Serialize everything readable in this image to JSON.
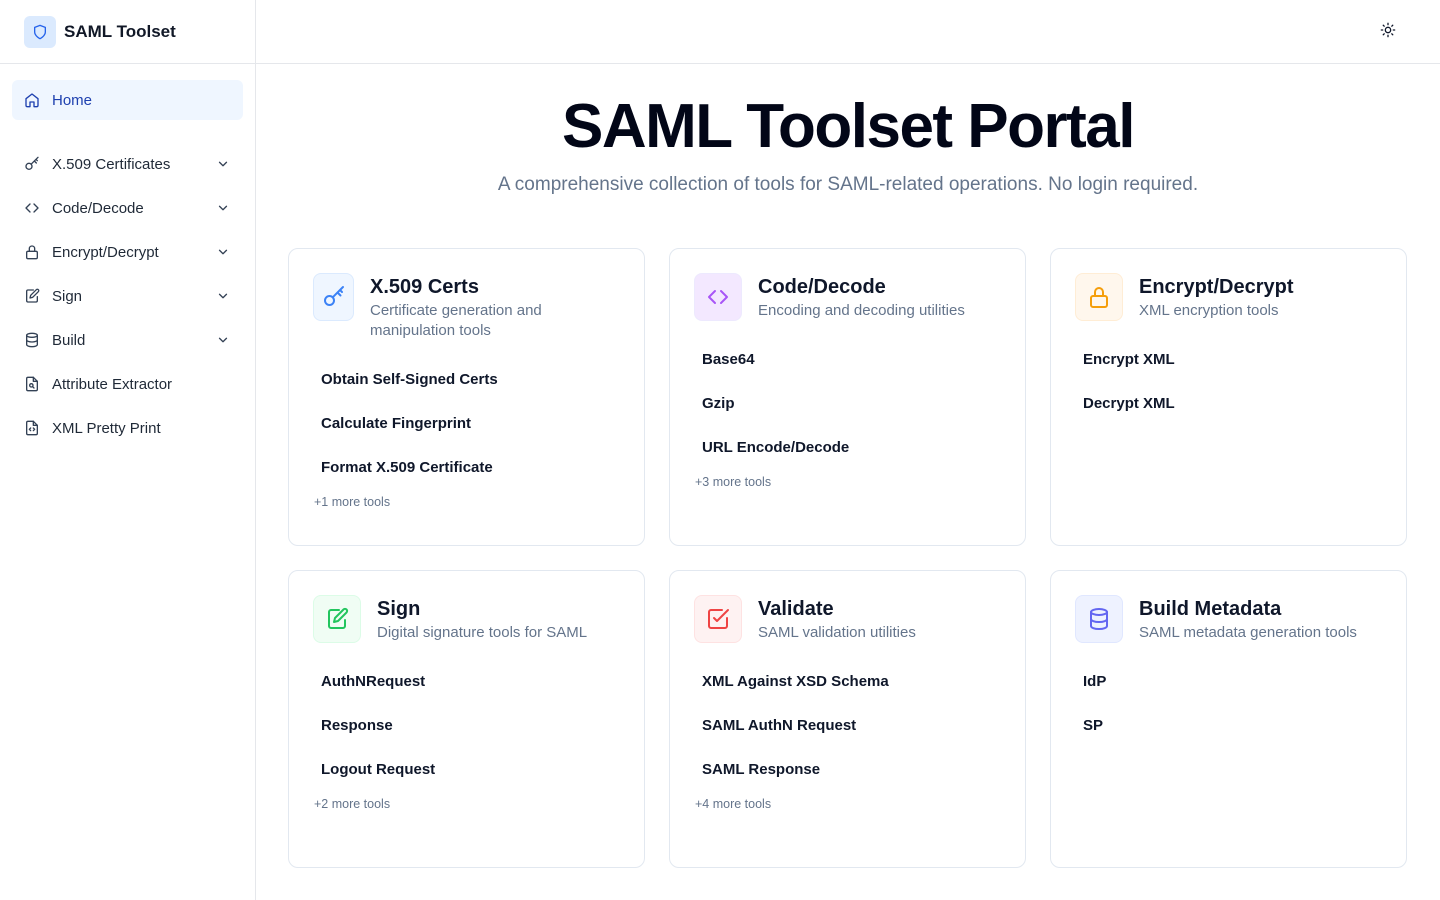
{
  "brand": {
    "title": "SAML Toolset"
  },
  "sidebar": {
    "items": [
      {
        "label": "Home",
        "icon": "home-icon",
        "active": true
      },
      {
        "label": "X.509 Certificates",
        "icon": "key-icon",
        "expandable": true
      },
      {
        "label": "Code/Decode",
        "icon": "code-icon",
        "expandable": true
      },
      {
        "label": "Encrypt/Decrypt",
        "icon": "lock-icon",
        "expandable": true
      },
      {
        "label": "Sign",
        "icon": "edit-icon",
        "expandable": true
      },
      {
        "label": "Build",
        "icon": "database-icon",
        "expandable": true
      },
      {
        "label": "Attribute Extractor",
        "icon": "file-search-icon",
        "expandable": false
      },
      {
        "label": "XML Pretty Print",
        "icon": "file-code-icon",
        "expandable": false
      }
    ]
  },
  "topbar": {
    "theme_icon": "sun-icon"
  },
  "hero": {
    "title": "SAML Toolset Portal",
    "subtitle": "A comprehensive collection of tools for SAML-related operations. No login required."
  },
  "colors": {
    "accent": "#1e40af",
    "blue_bg": "#eff6ff",
    "blue_fg": "#3b82f6",
    "purple_bg": "#f3e8ff",
    "purple_fg": "#a855f7",
    "orange_bg": "#fff7ed",
    "orange_fg": "#f59e0b",
    "green_bg": "#f0fdf4",
    "green_fg": "#22c55e",
    "red_bg": "#fef2f2",
    "red_fg": "#ef4444",
    "indigo_bg": "#eef2ff",
    "indigo_fg": "#6366f1"
  },
  "cards": [
    {
      "title": "X.509 Certs",
      "desc": "Certificate generation and manipulation tools",
      "icon": "key-icon",
      "tools": [
        "Obtain Self-Signed Certs",
        "Calculate Fingerprint",
        "Format X.509 Certificate"
      ],
      "more": "+1 more tools"
    },
    {
      "title": "Code/Decode",
      "desc": "Encoding and decoding utilities",
      "icon": "code-icon",
      "tools": [
        "Base64",
        "Gzip",
        "URL Encode/Decode"
      ],
      "more": "+3 more tools"
    },
    {
      "title": "Encrypt/Decrypt",
      "desc": "XML encryption tools",
      "icon": "lock-icon",
      "tools": [
        "Encrypt XML",
        "Decrypt XML"
      ],
      "more": ""
    },
    {
      "title": "Sign",
      "desc": "Digital signature tools for SAML",
      "icon": "edit-icon",
      "tools": [
        "AuthNRequest",
        "Response",
        "Logout Request"
      ],
      "more": "+2 more tools"
    },
    {
      "title": "Validate",
      "desc": "SAML validation utilities",
      "icon": "check-square-icon",
      "tools": [
        "XML Against XSD Schema",
        "SAML AuthN Request",
        "SAML Response"
      ],
      "more": "+4 more tools"
    },
    {
      "title": "Build Metadata",
      "desc": "SAML metadata generation tools",
      "icon": "database-icon",
      "tools": [
        "IdP",
        "SP"
      ],
      "more": ""
    }
  ]
}
